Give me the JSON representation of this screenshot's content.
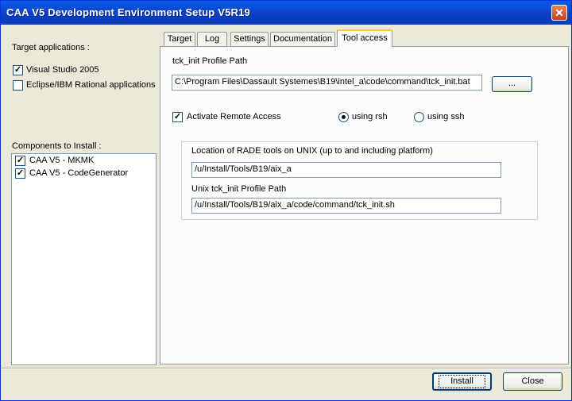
{
  "window": {
    "title": "CAA V5 Development Environment Setup V5R19",
    "close_glyph": "✕"
  },
  "left": {
    "target_label": "Target applications :",
    "targets": [
      {
        "label": "Visual Studio 2005",
        "checked": true
      },
      {
        "label": "Eclipse/IBM Rational applications",
        "checked": false
      }
    ],
    "components_label": "Components to Install :",
    "components": [
      {
        "label": "CAA V5 - MKMK",
        "checked": true
      },
      {
        "label": "CAA V5 - CodeGenerator",
        "checked": true
      }
    ]
  },
  "tabs": [
    {
      "label": "Target",
      "active": false
    },
    {
      "label": "Log",
      "active": false
    },
    {
      "label": "Settings",
      "active": false
    },
    {
      "label": "Documentation",
      "active": false
    },
    {
      "label": "Tool access",
      "active": true
    }
  ],
  "tool_access": {
    "profile_label": "tck_init Profile Path",
    "profile_value": "C:\\Program Files\\Dassault Systemes\\B19\\intel_a\\code\\command\\tck_init.bat",
    "browse_label": "...",
    "remote_label": "Activate Remote Access",
    "remote_checked": true,
    "rsh_label": "using rsh",
    "ssh_label": "using ssh",
    "rsh_selected": true,
    "rade_label": "Location of RADE tools on UNIX (up to and including platform)",
    "rade_value": "/u/Install/Tools/B19/aix_a",
    "unix_label": "Unix tck_init Profile Path",
    "unix_value": "/u/Install/Tools/B19/aix_a/code/command/tck_init.sh"
  },
  "footer": {
    "install_label": "Install",
    "close_label": "Close"
  },
  "check_glyph": "✓"
}
